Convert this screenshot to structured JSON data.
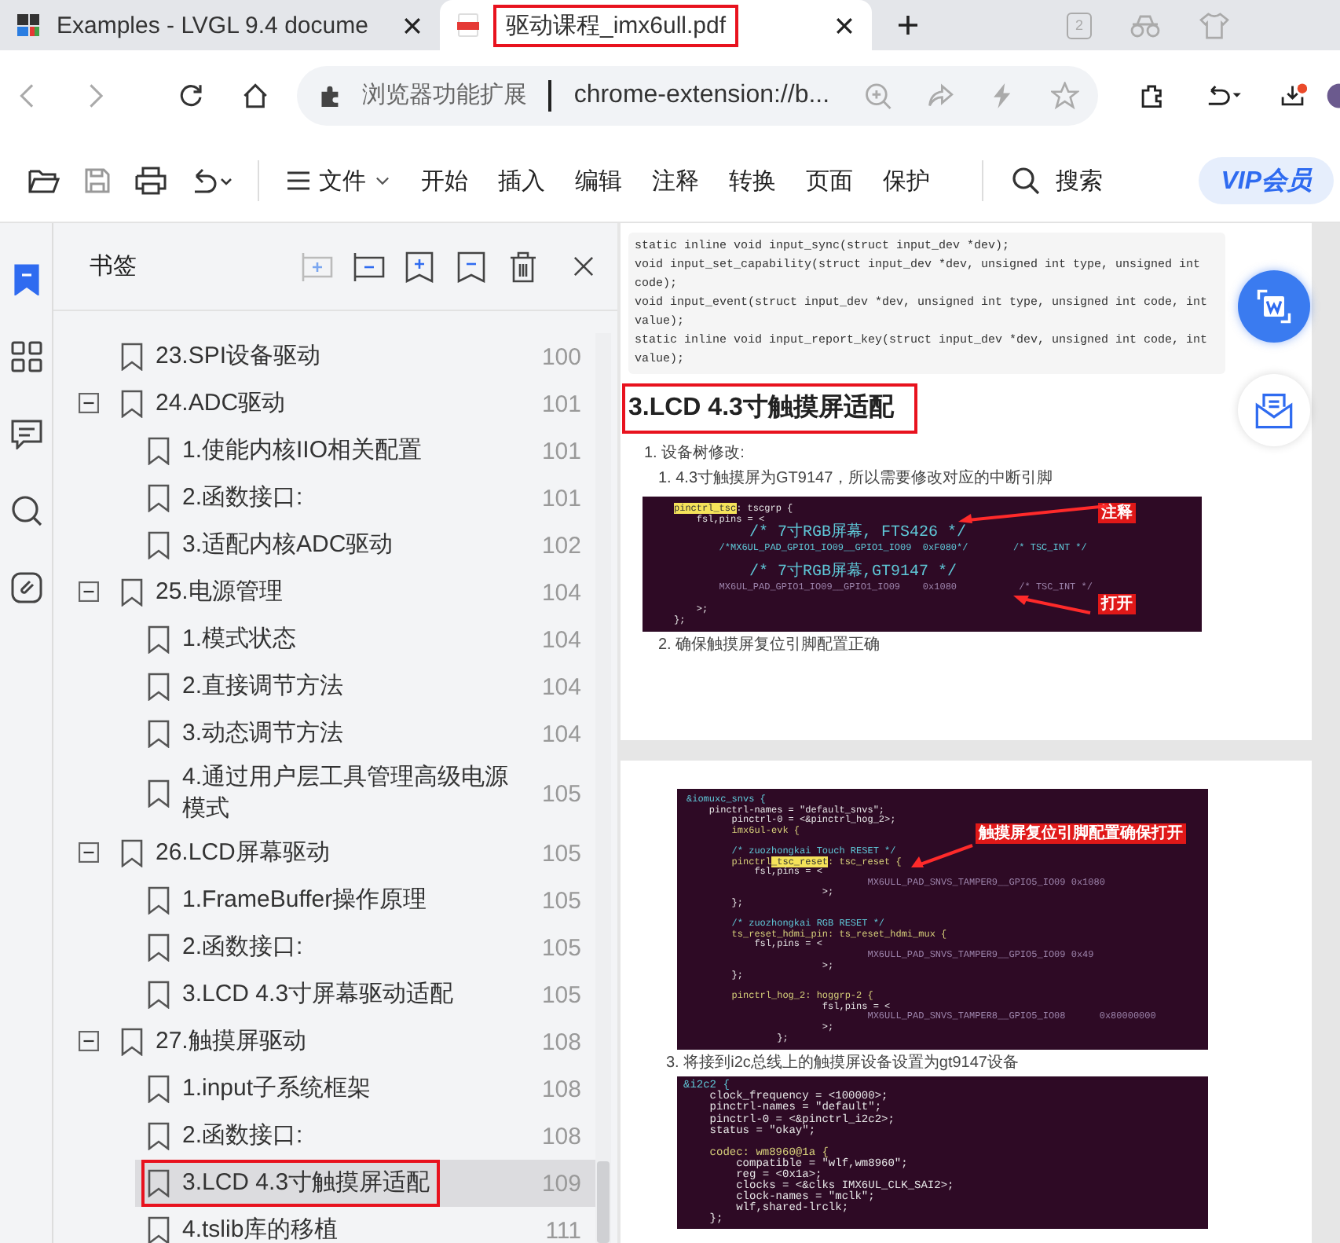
{
  "tabs": [
    {
      "title": "Examples - LVGL 9.4 docume",
      "kind": "lvgl",
      "selected": false,
      "red_box": false
    },
    {
      "title": "驱动课程_imx6ull.pdf",
      "kind": "pdf",
      "selected": true,
      "red_box": true
    }
  ],
  "tab_count": "2",
  "address_bar": {
    "extension_label": "浏览器功能扩展",
    "url": "chrome-extension://b..."
  },
  "toolbar": {
    "file_menu": "文件",
    "menus": [
      "开始",
      "插入",
      "编辑",
      "注释",
      "转换",
      "页面",
      "保护"
    ],
    "search": "搜索",
    "vip": "VIP会员"
  },
  "rail": [
    {
      "kind": "bookmark",
      "selected": true
    },
    {
      "kind": "thumbnails",
      "selected": false
    },
    {
      "kind": "comments",
      "selected": false
    },
    {
      "kind": "search",
      "selected": false
    },
    {
      "kind": "attachments",
      "selected": false
    }
  ],
  "sidebar": {
    "title": "书签",
    "items": [
      {
        "title": "23.SPI设备驱动",
        "page": "100",
        "selected": false
      },
      {
        "title": "24.ADC驱动",
        "page": "101",
        "selected": false,
        "expanded": true,
        "children": [
          {
            "title": "1.使能内核IIO相关配置",
            "page": "101",
            "selected": false
          },
          {
            "title": "2.函数接口:",
            "page": "101",
            "selected": false
          },
          {
            "title": "3.适配内核ADC驱动",
            "page": "102",
            "selected": false
          }
        ]
      },
      {
        "title": "25.电源管理",
        "page": "104",
        "selected": false,
        "expanded": true,
        "children": [
          {
            "title": "1.模式状态",
            "page": "104",
            "selected": false
          },
          {
            "title": "2.直接调节方法",
            "page": "104",
            "selected": false
          },
          {
            "title": "3.动态调节方法",
            "page": "104",
            "selected": false
          },
          {
            "title": "4.通过用户层工具管理高级电源模式",
            "page": "105",
            "selected": false
          }
        ]
      },
      {
        "title": "26.LCD屏幕驱动",
        "page": "105",
        "selected": false,
        "expanded": true,
        "children": [
          {
            "title": "1.FrameBuffer操作原理",
            "page": "105",
            "selected": false
          },
          {
            "title": "2.函数接口:",
            "page": "105",
            "selected": false
          },
          {
            "title": "3.LCD 4.3寸屏幕驱动适配",
            "page": "105",
            "selected": false
          }
        ]
      },
      {
        "title": "27.触摸屏驱动",
        "page": "108",
        "selected": false,
        "expanded": true,
        "children": [
          {
            "title": "1.input子系统框架",
            "page": "108",
            "selected": false
          },
          {
            "title": "2.函数接口:",
            "page": "108",
            "selected": false
          },
          {
            "title": "3.LCD 4.3寸触摸屏适配",
            "page": "109",
            "selected": true,
            "red_box": true
          },
          {
            "title": "4.tslib库的移植",
            "page": "111",
            "selected": false
          }
        ]
      }
    ]
  },
  "page1": {
    "code": [
      "static inline void input_sync(struct input_dev *dev);",
      "void input_set_capability(struct input_dev *dev, unsigned int type, unsigned int",
      "code);",
      "void input_event(struct input_dev *dev, unsigned int type, unsigned int code, int",
      "value);",
      "static inline void input_report_key(struct input_dev *dev, unsigned int code, int",
      "value);"
    ],
    "heading": "3.LCD 4.3寸触摸屏适配",
    "heading_red_box": true,
    "steps": [
      {
        "text": "1. 设备树修改:",
        "children": [
          {
            "text": "1. 4.3寸触摸屏为GT9147，所以需要修改对应的中断引脚",
            "figure": {
              "lines": [
                {
                  "kind": "code",
                  "mark": "pinctrl_tsc",
                  "text": ": tscgrp {"
                },
                {
                  "kind": "code",
                  "text": "    fsl,pins = <"
                },
                {
                  "kind": "code",
                  "text": "        /* 7寸RGB屏幕, FTS426 */",
                  "color": "#5fc8d8"
                },
                {
                  "kind": "code",
                  "text": "        /*MX6UL_PAD_GPIO1_IO09__GPIO1_IO09  0xF080*/        /* TSC_INT */",
                  "color": "#5fc8d8"
                },
                {
                  "kind": "blank"
                },
                {
                  "kind": "code",
                  "text": "        /* 7寸RGB屏幕,GT9147 */",
                  "color": "#5fc8d8"
                },
                {
                  "kind": "code",
                  "text": "        MX6UL_PAD_GPIO1_IO09__GPIO1_IO09    0x1080           /* TSC_INT */",
                  "color": "#9c83aa"
                },
                {
                  "kind": "blank"
                },
                {
                  "kind": "code",
                  "text": "    >;"
                },
                {
                  "kind": "code",
                  "text": "};"
                }
              ],
              "notes": [
                "注释",
                "打开"
              ]
            }
          },
          {
            "text": "2. 确保触摸屏复位引脚配置正确"
          }
        ]
      }
    ]
  },
  "page2": {
    "figure": {
      "lines": [
        {
          "kind": "code",
          "text": "&iomuxc_snvs {",
          "color": "#5fc8d8"
        },
        {
          "kind": "code",
          "text": "    pinctrl-names = \"default_snvs\";"
        },
        {
          "kind": "code",
          "text": "        pinctrl-0 = <&pinctrl_hog_2>;"
        },
        {
          "kind": "code",
          "text": "        imx6ul-evk {",
          "color": "#d6cf7a"
        },
        {
          "kind": "blank"
        },
        {
          "kind": "code",
          "text": "        /* zuozhongkai Touch RESET */",
          "color": "#5fc8d8"
        },
        {
          "kind": "code",
          "pre": "        pinctrl",
          "mark": "_tsc_reset",
          "text": ": tsc_reset {",
          "color": "#d6cf7a"
        },
        {
          "kind": "code",
          "text": "            fsl,pins = <"
        },
        {
          "kind": "code",
          "text": "                                MX6ULL_PAD_SNVS_TAMPER9__GPIO5_IO09 0x1080",
          "color": "#9c83aa"
        },
        {
          "kind": "code",
          "text": "                        >;"
        },
        {
          "kind": "code",
          "text": "        };"
        },
        {
          "kind": "blank"
        },
        {
          "kind": "code",
          "text": "        /* zuozhongkai RGB RESET */",
          "color": "#5fc8d8"
        },
        {
          "kind": "code",
          "text": "        ts_reset_hdmi_pin: ts_reset_hdmi_mux {",
          "color": "#d6cf7a"
        },
        {
          "kind": "code",
          "text": "            fsl,pins = <"
        },
        {
          "kind": "code",
          "text": "                                MX6ULL_PAD_SNVS_TAMPER9__GPIO5_IO09 0x49",
          "color": "#9c83aa"
        },
        {
          "kind": "code",
          "text": "                        >;"
        },
        {
          "kind": "code",
          "text": "        };"
        },
        {
          "kind": "blank"
        },
        {
          "kind": "code",
          "text": "        pinctrl_hog_2: hoggrp-2 {",
          "color": "#d6cf7a"
        },
        {
          "kind": "code",
          "text": "                        fsl,pins = <"
        },
        {
          "kind": "code",
          "text": "                                MX6ULL_PAD_SNVS_TAMPER8__GPIO5_IO08      0x80000000",
          "color": "#9c83aa"
        },
        {
          "kind": "code",
          "text": "                        >;"
        },
        {
          "kind": "code",
          "text": "                };"
        }
      ],
      "notes": [
        "触摸屏复位引脚配置确保打开"
      ]
    },
    "step": "3. 将接到i2c总线上的触摸屏设备设置为gt9147设备",
    "figure2": {
      "lines": [
        {
          "kind": "code",
          "text": "&i2c2 {",
          "color": "#5fc8d8"
        },
        {
          "kind": "code",
          "text": "    clock_frequency = <100000>;"
        },
        {
          "kind": "code",
          "text": "    pinctrl-names = \"default\";"
        },
        {
          "kind": "code",
          "text": "    pinctrl-0 = <&pinctrl_i2c2>;"
        },
        {
          "kind": "code",
          "text": "    status = \"okay\";"
        },
        {
          "kind": "blank"
        },
        {
          "kind": "code",
          "text": "    codec: wm8960@1a {",
          "color": "#d6cf7a"
        },
        {
          "kind": "code",
          "text": "        compatible = \"wlf,wm8960\";"
        },
        {
          "kind": "code",
          "text": "        reg = <0x1a>;"
        },
        {
          "kind": "code",
          "text": "        clocks = <&clks IMX6UL_CLK_SAI2>;"
        },
        {
          "kind": "code",
          "text": "        clock-names = \"mclk\";"
        },
        {
          "kind": "code",
          "text": "        wlf,shared-lrclk;"
        },
        {
          "kind": "code",
          "text": "    };"
        }
      ]
    }
  }
}
